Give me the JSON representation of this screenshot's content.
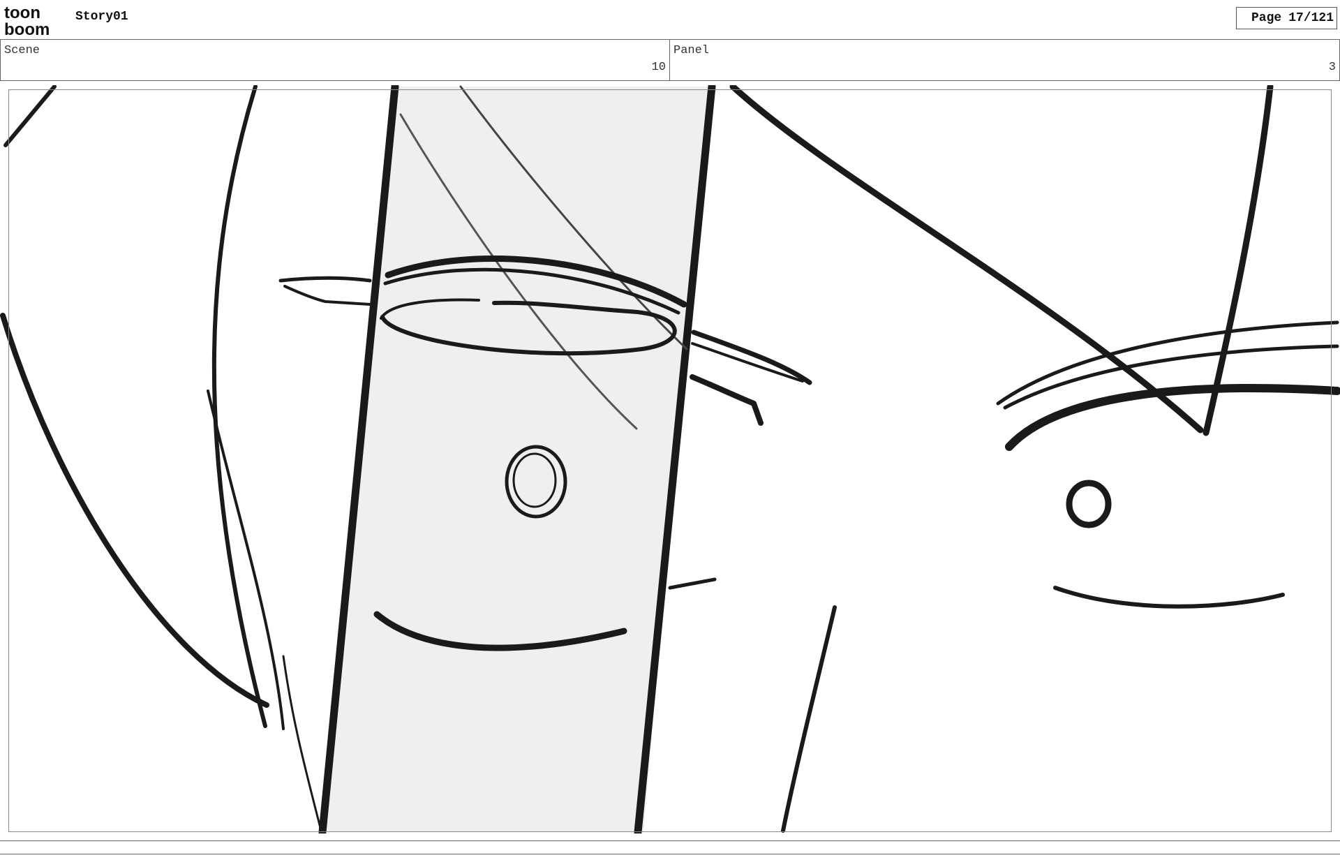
{
  "header": {
    "logo_top": "toon",
    "logo_bottom": "boom",
    "story_title": "Story01",
    "page_label": "Page",
    "page_value": "17/121"
  },
  "info": {
    "scene_label": "Scene",
    "scene_value": "10",
    "panel_label": "Panel",
    "panel_value": "3"
  },
  "drawing": {
    "ink_color": "#1a1a1a",
    "shade_color": "#efefef"
  }
}
